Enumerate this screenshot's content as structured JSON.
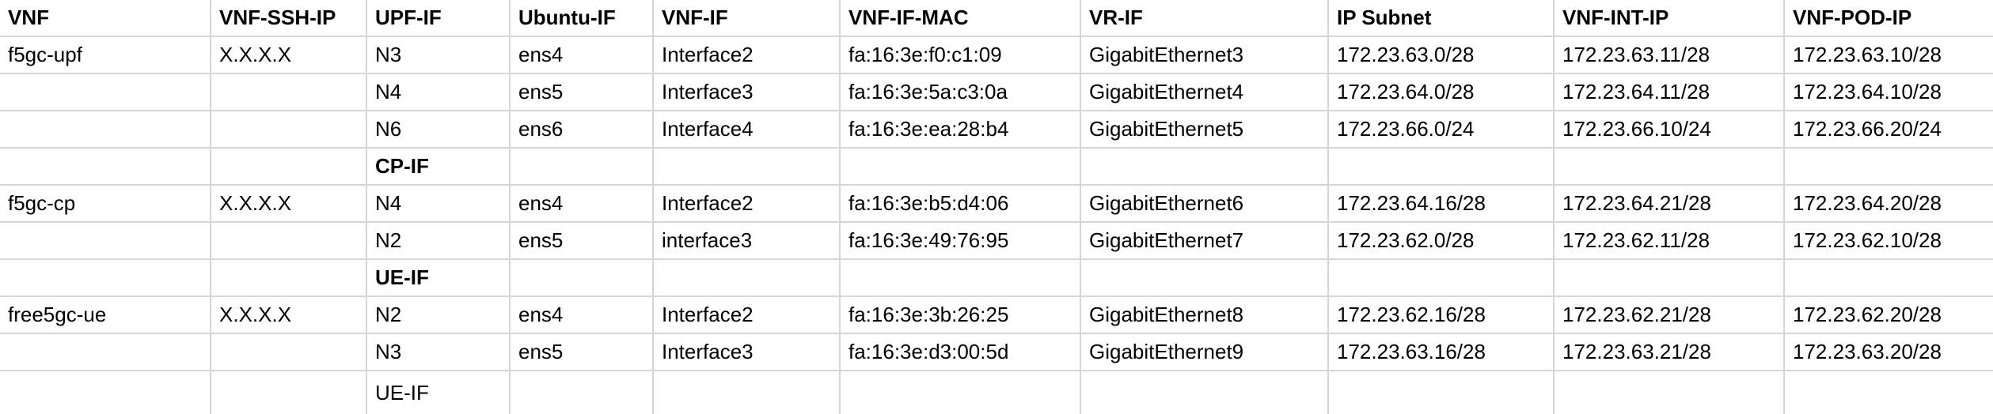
{
  "columns": [
    "VNF",
    "VNF-SSH-IP",
    "UPF-IF",
    "Ubuntu-IF",
    "VNF-IF",
    "VNF-IF-MAC",
    "VR-IF",
    "IP Subnet",
    "VNF-INT-IP",
    "VNF-POD-IP"
  ],
  "rows": [
    {
      "type": "data",
      "cells": [
        "f5gc-upf",
        "X.X.X.X",
        "N3",
        "ens4",
        "Interface2",
        "fa:16:3e:f0:c1:09",
        "GigabitEthernet3",
        "172.23.63.0/28",
        "172.23.63.11/28",
        "172.23.63.10/28"
      ]
    },
    {
      "type": "data",
      "cells": [
        "",
        "",
        "N4",
        "ens5",
        "Interface3",
        "fa:16:3e:5a:c3:0a",
        "GigabitEthernet4",
        "172.23.64.0/28",
        "172.23.64.11/28",
        "172.23.64.10/28"
      ]
    },
    {
      "type": "data",
      "cells": [
        "",
        "",
        "N6",
        "ens6",
        "Interface4",
        "fa:16:3e:ea:28:b4",
        "GigabitEthernet5",
        "172.23.66.0/24",
        "172.23.66.10/24",
        "172.23.66.20/24"
      ]
    },
    {
      "type": "label",
      "cells": [
        "",
        "",
        "CP-IF",
        "",
        "",
        "",
        "",
        "",
        "",
        ""
      ]
    },
    {
      "type": "data",
      "cells": [
        "f5gc-cp",
        "X.X.X.X",
        "N4",
        "ens4",
        "Interface2",
        "fa:16:3e:b5:d4:06",
        "GigabitEthernet6",
        "172.23.64.16/28",
        "172.23.64.21/28",
        "172.23.64.20/28"
      ]
    },
    {
      "type": "data",
      "cells": [
        "",
        "",
        "N2",
        "ens5",
        "interface3",
        "fa:16:3e:49:76:95",
        "GigabitEthernet7",
        "172.23.62.0/28",
        "172.23.62.11/28",
        "172.23.62.10/28"
      ]
    },
    {
      "type": "label",
      "cells": [
        "",
        "",
        "UE-IF",
        "",
        "",
        "",
        "",
        "",
        "",
        ""
      ]
    },
    {
      "type": "data",
      "cells": [
        "free5gc-ue",
        "X.X.X.X",
        "N2",
        "ens4",
        "Interface2",
        "fa:16:3e:3b:26:25",
        "GigabitEthernet8",
        "172.23.62.16/28",
        "172.23.62.21/28",
        "172.23.62.20/28"
      ]
    },
    {
      "type": "data",
      "cells": [
        "",
        "",
        "N3",
        "ens5",
        "Interface3",
        "fa:16:3e:d3:00:5d",
        "GigabitEthernet9",
        "172.23.63.16/28",
        "172.23.63.21/28",
        "172.23.63.20/28"
      ]
    },
    {
      "type": "cut",
      "cells": [
        "",
        "",
        "UE-IF",
        "",
        "",
        "",
        "",
        "",
        "",
        ""
      ]
    }
  ]
}
